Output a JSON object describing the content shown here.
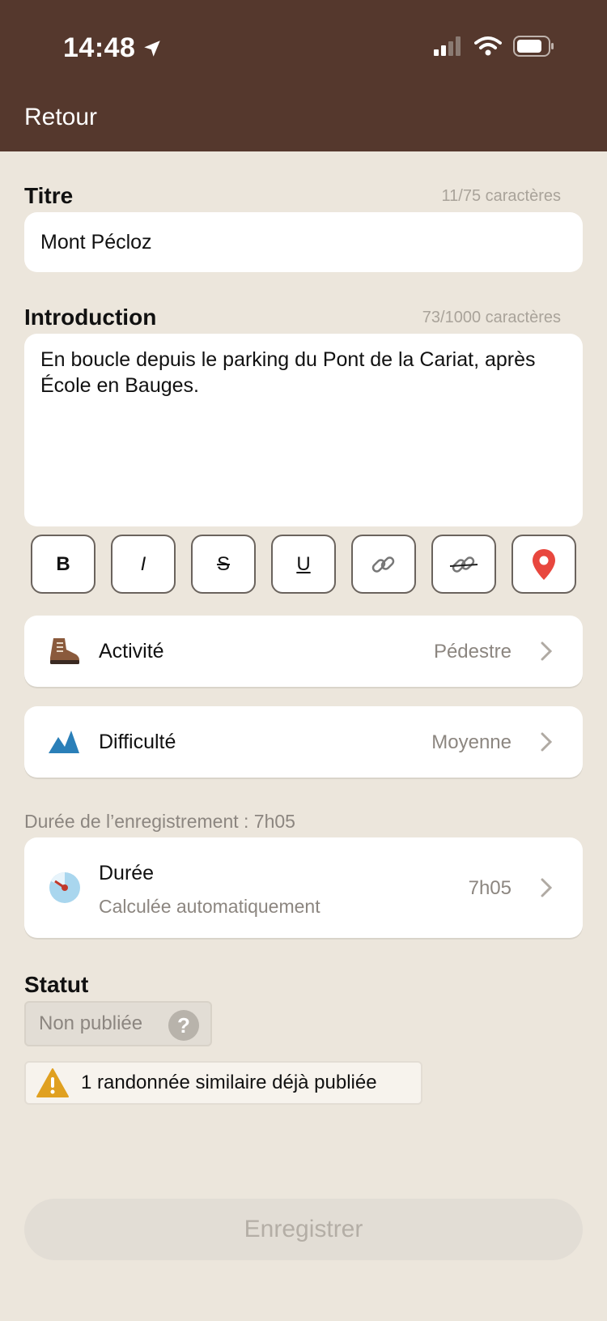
{
  "status_bar": {
    "time": "14:48"
  },
  "nav": {
    "back_label": "Retour"
  },
  "title_field": {
    "label": "Titre",
    "counter": "11/75 caractères",
    "value": "Mont Pécloz"
  },
  "intro_field": {
    "label": "Introduction",
    "counter": "73/1000 caractères",
    "value": "En boucle depuis le parking du Pont de la Cariat, après École en Bauges."
  },
  "format_toolbar": {
    "bold": "B",
    "italic": "I",
    "strike": "S",
    "underline": "U"
  },
  "activity": {
    "label": "Activité",
    "value": "Pédestre"
  },
  "difficulty": {
    "label": "Difficulté",
    "value": "Moyenne"
  },
  "duration": {
    "recording_info": "Durée de l’enregistrement : 7h05",
    "label": "Durée",
    "sublabel": "Calculée automatiquement",
    "value": "7h05"
  },
  "status": {
    "label": "Statut",
    "value": "Non publiée",
    "help": "?"
  },
  "warning": {
    "text": "1 randonnée similaire déjà publiée"
  },
  "save_button": {
    "label": "Enregistrer"
  },
  "colors": {
    "header": "#55382d",
    "background": "#ece6dc",
    "pin": "#e8473e",
    "mountain": "#2a7fb8",
    "warning": "#e0a020"
  }
}
